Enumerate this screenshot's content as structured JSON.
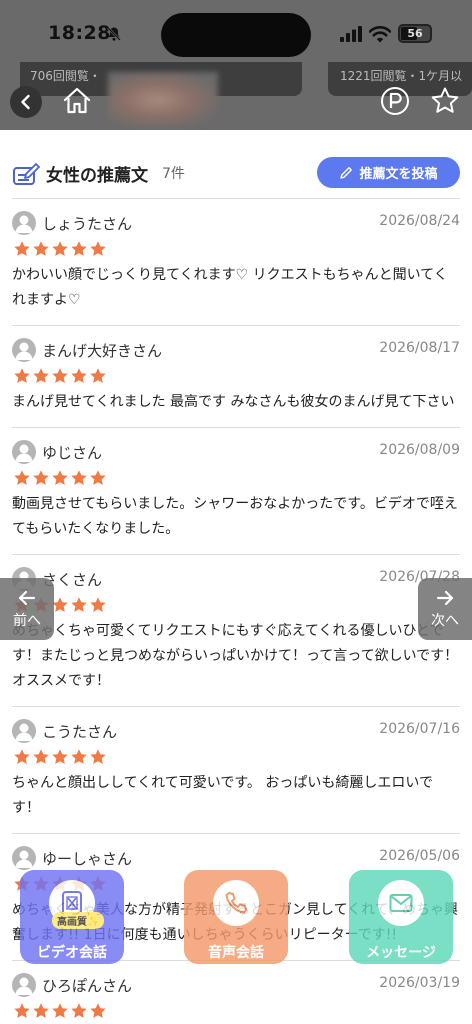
{
  "status": {
    "time": "18:28",
    "battery": "56",
    "battery_level": 0.56
  },
  "thumbs": {
    "left_text": "706回閲覧・",
    "right_text": "1221回閲覧・1ケ月以"
  },
  "header": {
    "title": "女性の推薦文",
    "count": "7件",
    "post_label": "推薦文を投稿"
  },
  "reviews": [
    {
      "name": "しょうたさん",
      "date": "2026/08/24",
      "rating": 5,
      "text": "かわいい顔でじっくり見てくれます♡ リクエストもちゃんと聞いてくれますよ♡"
    },
    {
      "name": "まんげ大好きさん",
      "date": "2026/08/17",
      "rating": 5,
      "text": "まんげ見せてくれました 最高です みなさんも彼女のまんげ見て下さい"
    },
    {
      "name": "ゆじさん",
      "date": "2026/08/09",
      "rating": 5,
      "text": "動画見させてもらいました。シャワーおなよかったです。ビデオで咥えてもらいたくなりました。"
    },
    {
      "name": "さくさん",
      "date": "2026/07/28",
      "rating": 5,
      "text": "めちゃくちゃ可愛くてリクエストにもすぐ応えてくれる優しいひとです！またじっと見つめながらいっぱいかけて！って言って欲しいです！オススメです！"
    },
    {
      "name": "こうたさん",
      "date": "2026/07/16",
      "rating": 5,
      "text": "ちゃんと顔出ししてくれて可愛いです。 おっぱいも綺麗しエロいです！"
    },
    {
      "name": "ゆーしゃさん",
      "date": "2026/05/06",
      "rating": 5,
      "text": "めちゃくちゃ美人な方が精子発射するとこガン見してくれて、めちゃ興奮します!! 1日に何度も通いしちゃうくらいリピーターです!!"
    },
    {
      "name": "ひろぽんさん",
      "date": "2026/03/19",
      "rating": 5,
      "text": ""
    }
  ],
  "nav": {
    "prev_label": "前へ",
    "next_label": "次へ"
  },
  "actions": {
    "video_label": "ビデオ会話",
    "hd_badge": "高画質✨",
    "voice_label": "音声会話",
    "message_label": "メッセージ"
  },
  "colors": {
    "accent": "#5d79f0",
    "star": "#f07a45",
    "video": "#6f73f2",
    "voice": "#f39a6a",
    "message": "#5dd8b9"
  }
}
